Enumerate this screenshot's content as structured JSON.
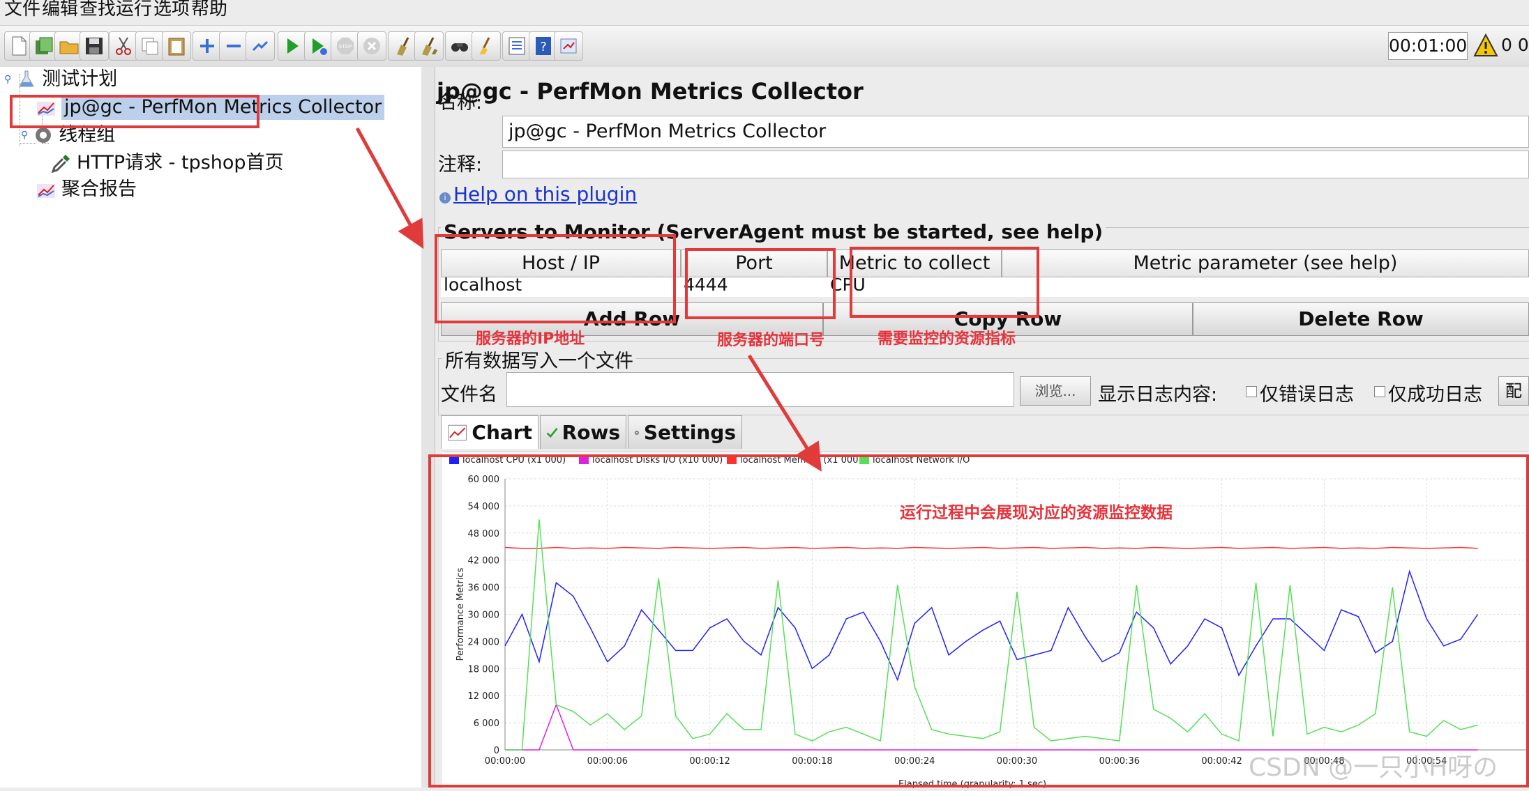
{
  "menu": [
    "文件",
    "编辑",
    "查找",
    "运行",
    "选项",
    "帮助"
  ],
  "toolbar": {
    "icons": [
      "new-icon",
      "templates-icon",
      "open-icon",
      "save-icon",
      "cut-icon",
      "copy-icon",
      "paste-icon",
      "expand-icon",
      "collapse-icon",
      "toggle-icon",
      "start-icon",
      "start-no-pause-icon",
      "stop-icon",
      "shutdown-icon",
      "clear-icon",
      "clear-all-icon",
      "search-icon",
      "reset-search-icon",
      "function-helper-icon",
      "help-icon",
      "remote-icon"
    ],
    "timer": "00:01:00",
    "warning_count": "0 0"
  },
  "tree": {
    "root": "测试计划",
    "collector": "jp@gc - PerfMon Metrics Collector",
    "thread_group": "线程组",
    "http_request": "HTTP请求 - tpshop首页",
    "aggregate_report": "聚合报告"
  },
  "panel": {
    "title": "jp@gc - PerfMon Metrics Collector",
    "name_label": "名称:",
    "name_value": "jp@gc - PerfMon Metrics Collector",
    "comment_label": "注释:",
    "comment_value": "",
    "help_link": "Help on this plugin",
    "servers_title": "Servers to Monitor (ServerAgent must be started, see help)",
    "columns": [
      "Host / IP",
      "Port",
      "Metric to collect",
      "Metric parameter (see help)"
    ],
    "row": {
      "host": "localhost",
      "port": "4444",
      "metric": "CPU",
      "param": ""
    },
    "buttons": {
      "add": "Add Row",
      "copy": "Copy Row",
      "delete": "Delete Row"
    },
    "file_section_title": "所有数据写入一个文件",
    "file_label": "文件名",
    "file_value": "",
    "browse_label": "浏览...",
    "log_label": "显示日志内容:",
    "errors_only": "仅错误日志",
    "success_only": "仅成功日志",
    "config_btn": "配",
    "tabs": [
      "Chart",
      "Rows",
      "Settings"
    ]
  },
  "annotations": {
    "ip": "服务器的IP地址",
    "port": "服务器的端口号",
    "metric": "需要监控的资源指标",
    "chart": "运行过程中会展现对应的资源监控数据"
  },
  "watermark": "CSDN @一只小H呀の",
  "chart_data": {
    "type": "line",
    "ylabel": "Performance Metrics",
    "xlabel": "Elapsed time (granularity: 1 sec)",
    "ylim": [
      0,
      60000
    ],
    "yticks": [
      "0",
      "6 000",
      "12 000",
      "18 000",
      "24 000",
      "30 000",
      "36 000",
      "42 000",
      "48 000",
      "54 000",
      "60 000"
    ],
    "xticks": [
      "00:00:00",
      "00:00:06",
      "00:00:12",
      "00:00:18",
      "00:00:24",
      "00:00:30",
      "00:00:36",
      "00:00:42",
      "00:00:48",
      "00:00:54"
    ],
    "x_seconds": [
      0,
      1,
      2,
      3,
      4,
      5,
      6,
      7,
      8,
      9,
      10,
      11,
      12,
      13,
      14,
      15,
      16,
      17,
      18,
      19,
      20,
      21,
      22,
      23,
      24,
      25,
      26,
      27,
      28,
      29,
      30,
      31,
      32,
      33,
      34,
      35,
      36,
      37,
      38,
      39,
      40,
      41,
      42,
      43,
      44,
      45,
      46,
      47,
      48,
      49,
      50,
      51,
      52,
      53,
      54,
      55,
      56,
      57
    ],
    "series": [
      {
        "name": "localhost CPU (x1 000)",
        "color": "#2020ff",
        "values": [
          23000,
          30000,
          19500,
          37000,
          34000,
          27000,
          19500,
          23000,
          31000,
          26500,
          22000,
          22000,
          27000,
          29000,
          24000,
          21000,
          31500,
          27000,
          18000,
          21000,
          29000,
          30500,
          24000,
          15500,
          28000,
          31500,
          21000,
          24000,
          26500,
          28500,
          20000,
          21000,
          22000,
          31500,
          25000,
          19500,
          21500,
          30500,
          27000,
          19000,
          23000,
          29000,
          27000,
          16500,
          23000,
          29000,
          29000,
          25500,
          22000,
          31000,
          29500,
          21500,
          24000,
          39500,
          29000,
          23000,
          24500,
          30000
        ]
      },
      {
        "name": "localhost Disks I/O (x10 000)",
        "color": "#e020e0",
        "values": [
          0,
          0,
          0,
          10000,
          0,
          0,
          0,
          0,
          0,
          0,
          0,
          0,
          0,
          0,
          0,
          0,
          0,
          0,
          0,
          0,
          0,
          0,
          0,
          0,
          0,
          0,
          0,
          0,
          0,
          0,
          0,
          0,
          0,
          0,
          0,
          0,
          0,
          0,
          0,
          0,
          0,
          0,
          0,
          0,
          0,
          0,
          0,
          0,
          0,
          0,
          0,
          0,
          0,
          0,
          0,
          0,
          0,
          0
        ]
      },
      {
        "name": "localhost Memory (x1 000)",
        "color": "#ff3030",
        "values": [
          44800,
          44600,
          44600,
          44800,
          44600,
          44700,
          44600,
          44800,
          44700,
          44600,
          44800,
          44700,
          44600,
          44700,
          44800,
          44600,
          44700,
          44800,
          44600,
          44700,
          44800,
          44600,
          44700,
          44600,
          44800,
          44700,
          44600,
          44700,
          44800,
          44600,
          44700,
          44800,
          44600,
          44700,
          44800,
          44600,
          44700,
          44600,
          44800,
          44700,
          44600,
          44700,
          44800,
          44600,
          44700,
          44800,
          44600,
          44700,
          44800,
          44600,
          44700,
          44600,
          44800,
          44700,
          44600,
          44700,
          44800,
          44600
        ]
      },
      {
        "name": "localhost Network I/O",
        "color": "#55e055",
        "values": [
          0,
          0,
          51000,
          10000,
          8500,
          5500,
          8000,
          4500,
          7500,
          38000,
          7500,
          2500,
          3500,
          8000,
          4500,
          4500,
          37500,
          3500,
          2000,
          4000,
          5000,
          3500,
          2000,
          36500,
          14000,
          4500,
          3500,
          3000,
          2500,
          4000,
          35000,
          5000,
          2000,
          2500,
          3000,
          2500,
          2000,
          36500,
          9000,
          7000,
          4000,
          8000,
          3500,
          2000,
          37000,
          3000,
          36500,
          3500,
          5000,
          4000,
          5500,
          8000,
          36000,
          4000,
          3000,
          6500,
          4500,
          5500
        ]
      }
    ]
  }
}
